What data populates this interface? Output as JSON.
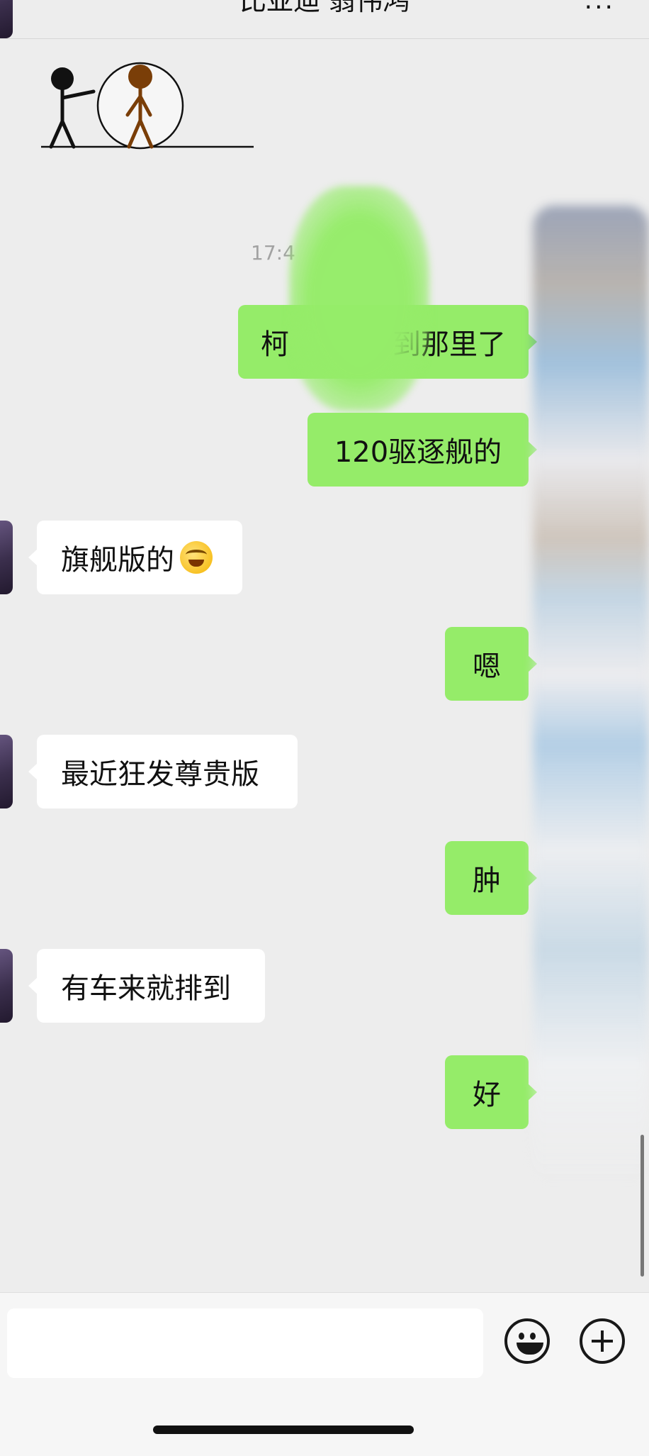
{
  "header": {
    "title": "比亚迪 翁伟鸿",
    "more_icon": "ellipsis-icon"
  },
  "timestamp": "17:4",
  "messages": [
    {
      "side": "out",
      "text_left": "柯",
      "text_right": "到那里了"
    },
    {
      "side": "out",
      "text": "120驱逐舰的"
    },
    {
      "side": "in",
      "text": "旗舰版的",
      "emoji": "facepalm-crying-emoji"
    },
    {
      "side": "out",
      "text": "嗯"
    },
    {
      "side": "in",
      "text": "最近狂发尊贵版"
    },
    {
      "side": "out",
      "text": "肿"
    },
    {
      "side": "in",
      "text": "有车来就排到"
    },
    {
      "side": "out",
      "text": "好"
    }
  ],
  "composer": {
    "input_value": "",
    "emoji_icon": "smile-icon",
    "more_icon": "plus-icon"
  },
  "colors": {
    "background": "#ededed",
    "outgoing_bubble": "#95ec69",
    "incoming_bubble": "#ffffff"
  }
}
